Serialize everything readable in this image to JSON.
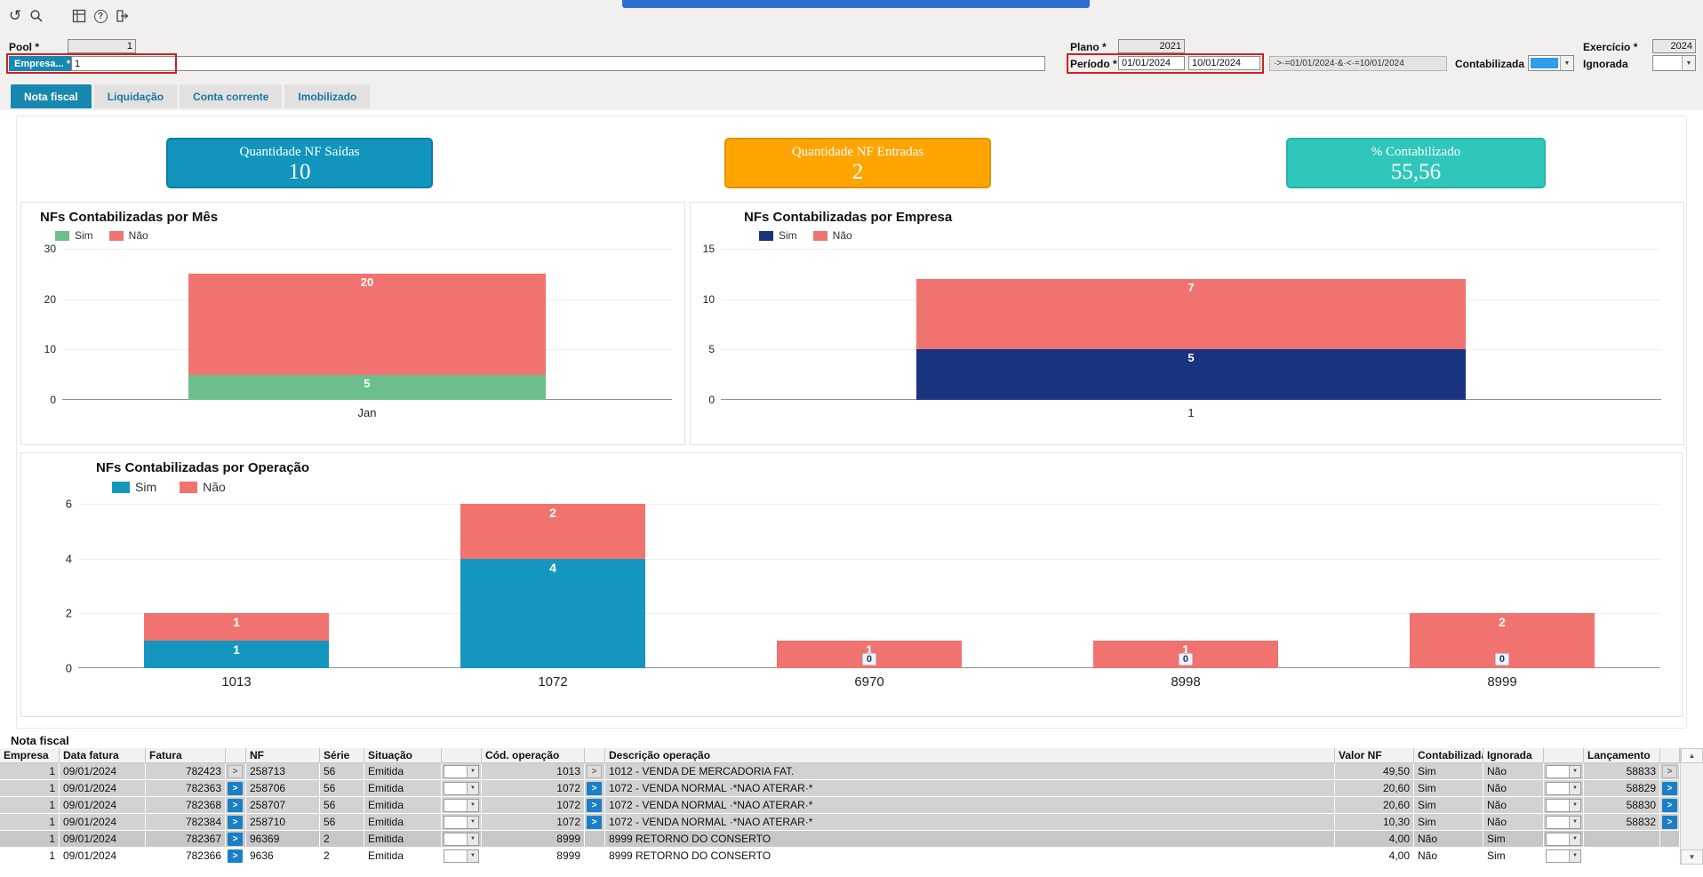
{
  "toolbar": {
    "icons": [
      "undo",
      "search",
      "grid",
      "help",
      "exit"
    ]
  },
  "filters": {
    "pool": {
      "label": "Pool *",
      "value": "1"
    },
    "empresa": {
      "label": "Empresa... *",
      "value": "1"
    },
    "plano": {
      "label": "Plano *",
      "value": "2021"
    },
    "exercicio": {
      "label": "Exercício *",
      "value": "2024"
    },
    "periodo": {
      "label": "Período *",
      "from": "01/01/2024",
      "to": "10/01/2024",
      "formula": "·>·=01/01/2024·&·<·=10/01/2024"
    },
    "contabilizada": {
      "label": "Contabilizada",
      "selected_color": "#2f9de8"
    },
    "ignorada": {
      "label": "Ignorada"
    },
    "highlight_color": "#d21f1f"
  },
  "tabs": [
    {
      "label": "Nota fiscal",
      "active": true
    },
    {
      "label": "Liquidação",
      "active": false
    },
    {
      "label": "Conta corrente",
      "active": false
    },
    {
      "label": "Imobilizado",
      "active": false
    }
  ],
  "kpis": [
    {
      "title": "Quantidade NF Saídas",
      "value": "10",
      "fill": "#1295bd",
      "border": "#0d7ea1"
    },
    {
      "title": "Quantidade NF Entradas",
      "value": "2",
      "fill": "#ffa400",
      "border": "#e29200"
    },
    {
      "title": "% Contabilizado",
      "value": "55,56",
      "fill": "#2fc7b9",
      "border": "#27b2a5"
    }
  ],
  "chart_data": [
    {
      "type": "bar",
      "stacked": true,
      "title": "NFs Contabilizadas por Mês",
      "categories": [
        "Jan"
      ],
      "series": [
        {
          "name": "Sim",
          "color": "#6cbe8c",
          "values": [
            5
          ]
        },
        {
          "name": "Não",
          "color": "#f1736f",
          "values": [
            20
          ]
        }
      ],
      "yticks": [
        0,
        10,
        20,
        30
      ],
      "ylim": [
        0,
        30
      ],
      "xlabel": "",
      "ylabel": "",
      "legend_position": "top-left",
      "grid": false
    },
    {
      "type": "bar",
      "stacked": true,
      "title": "NFs Contabilizadas por Empresa",
      "categories": [
        "1"
      ],
      "series": [
        {
          "name": "Sim",
          "color": "#1a3380",
          "values": [
            5
          ]
        },
        {
          "name": "Não",
          "color": "#f1736f",
          "values": [
            7
          ]
        }
      ],
      "yticks": [
        0,
        5,
        10,
        15
      ],
      "ylim": [
        0,
        15
      ],
      "xlabel": "",
      "ylabel": "",
      "legend_position": "top-left",
      "grid": false
    },
    {
      "type": "bar",
      "stacked": true,
      "title": "NFs Contabilizadas por Operação",
      "categories": [
        "1013",
        "1072",
        "6970",
        "8998",
        "8999"
      ],
      "series": [
        {
          "name": "Sim",
          "color": "#1596be",
          "values": [
            1,
            4,
            0,
            0,
            0
          ]
        },
        {
          "name": "Não",
          "color": "#f1736f",
          "values": [
            1,
            2,
            1,
            1,
            2
          ]
        }
      ],
      "yticks": [
        0,
        2,
        4,
        6
      ],
      "ylim": [
        0,
        6
      ],
      "xlabel": "",
      "ylabel": "",
      "legend_position": "top-left",
      "grid": false
    }
  ],
  "table": {
    "title": "Nota fiscal",
    "headers": {
      "empresa": "Empresa",
      "data_fatura": "Data fatura",
      "fatura": "Fatura",
      "nf": "NF",
      "serie": "Série",
      "situacao": "Situação",
      "cod_operacao": "Cód. operação",
      "descricao": "Descrição operação",
      "valor_nf": "Valor NF",
      "contabilizada": "Contabilizada",
      "ignorada": "Ignorada",
      "lancamento": "Lançamento"
    },
    "rows": [
      {
        "empresa": "1",
        "data_fatura": "09/01/2024",
        "fatura": "782423",
        "nf": "258713",
        "serie": "56",
        "situacao": "Emitida",
        "cod_operacao": "1013",
        "descricao": "1012 - VENDA DE MERCADORIA FAT.",
        "valor_nf": "49,50",
        "contabilizada": "Sim",
        "ignorada": "Não",
        "lancamento": "58833"
      },
      {
        "empresa": "1",
        "data_fatura": "09/01/2024",
        "fatura": "782363",
        "nf": "258706",
        "serie": "56",
        "situacao": "Emitida",
        "cod_operacao": "1072",
        "descricao": "1072 - VENDA NORMAL ·*NAO ATERAR·*",
        "valor_nf": "20,60",
        "contabilizada": "Sim",
        "ignorada": "Não",
        "lancamento": "58829"
      },
      {
        "empresa": "1",
        "data_fatura": "09/01/2024",
        "fatura": "782368",
        "nf": "258707",
        "serie": "56",
        "situacao": "Emitida",
        "cod_operacao": "1072",
        "descricao": "1072 - VENDA NORMAL ·*NAO ATERAR·*",
        "valor_nf": "20,60",
        "contabilizada": "Sim",
        "ignorada": "Não",
        "lancamento": "58830"
      },
      {
        "empresa": "1",
        "data_fatura": "09/01/2024",
        "fatura": "782384",
        "nf": "258710",
        "serie": "56",
        "situacao": "Emitida",
        "cod_operacao": "1072",
        "descricao": "1072 - VENDA NORMAL ·*NAO ATERAR·*",
        "valor_nf": "10,30",
        "contabilizada": "Sim",
        "ignorada": "Não",
        "lancamento": "58832"
      },
      {
        "empresa": "1",
        "data_fatura": "09/01/2024",
        "fatura": "782367",
        "nf": "96369",
        "serie": "2",
        "situacao": "Emitida",
        "cod_operacao": "8999",
        "descricao": "8999 RETORNO DO CONSERTO",
        "valor_nf": "4,00",
        "contabilizada": "Não",
        "ignorada": "Sim",
        "lancamento": ""
      },
      {
        "empresa": "1",
        "data_fatura": "09/01/2024",
        "fatura": "782366",
        "nf": "9636",
        "serie": "2",
        "situacao": "Emitida",
        "cod_operacao": "8999",
        "descricao": "8999 RETORNO DO CONSERTO",
        "valor_nf": "4,00",
        "contabilizada": "Não",
        "ignorada": "Sim",
        "lancamento": ""
      }
    ]
  }
}
